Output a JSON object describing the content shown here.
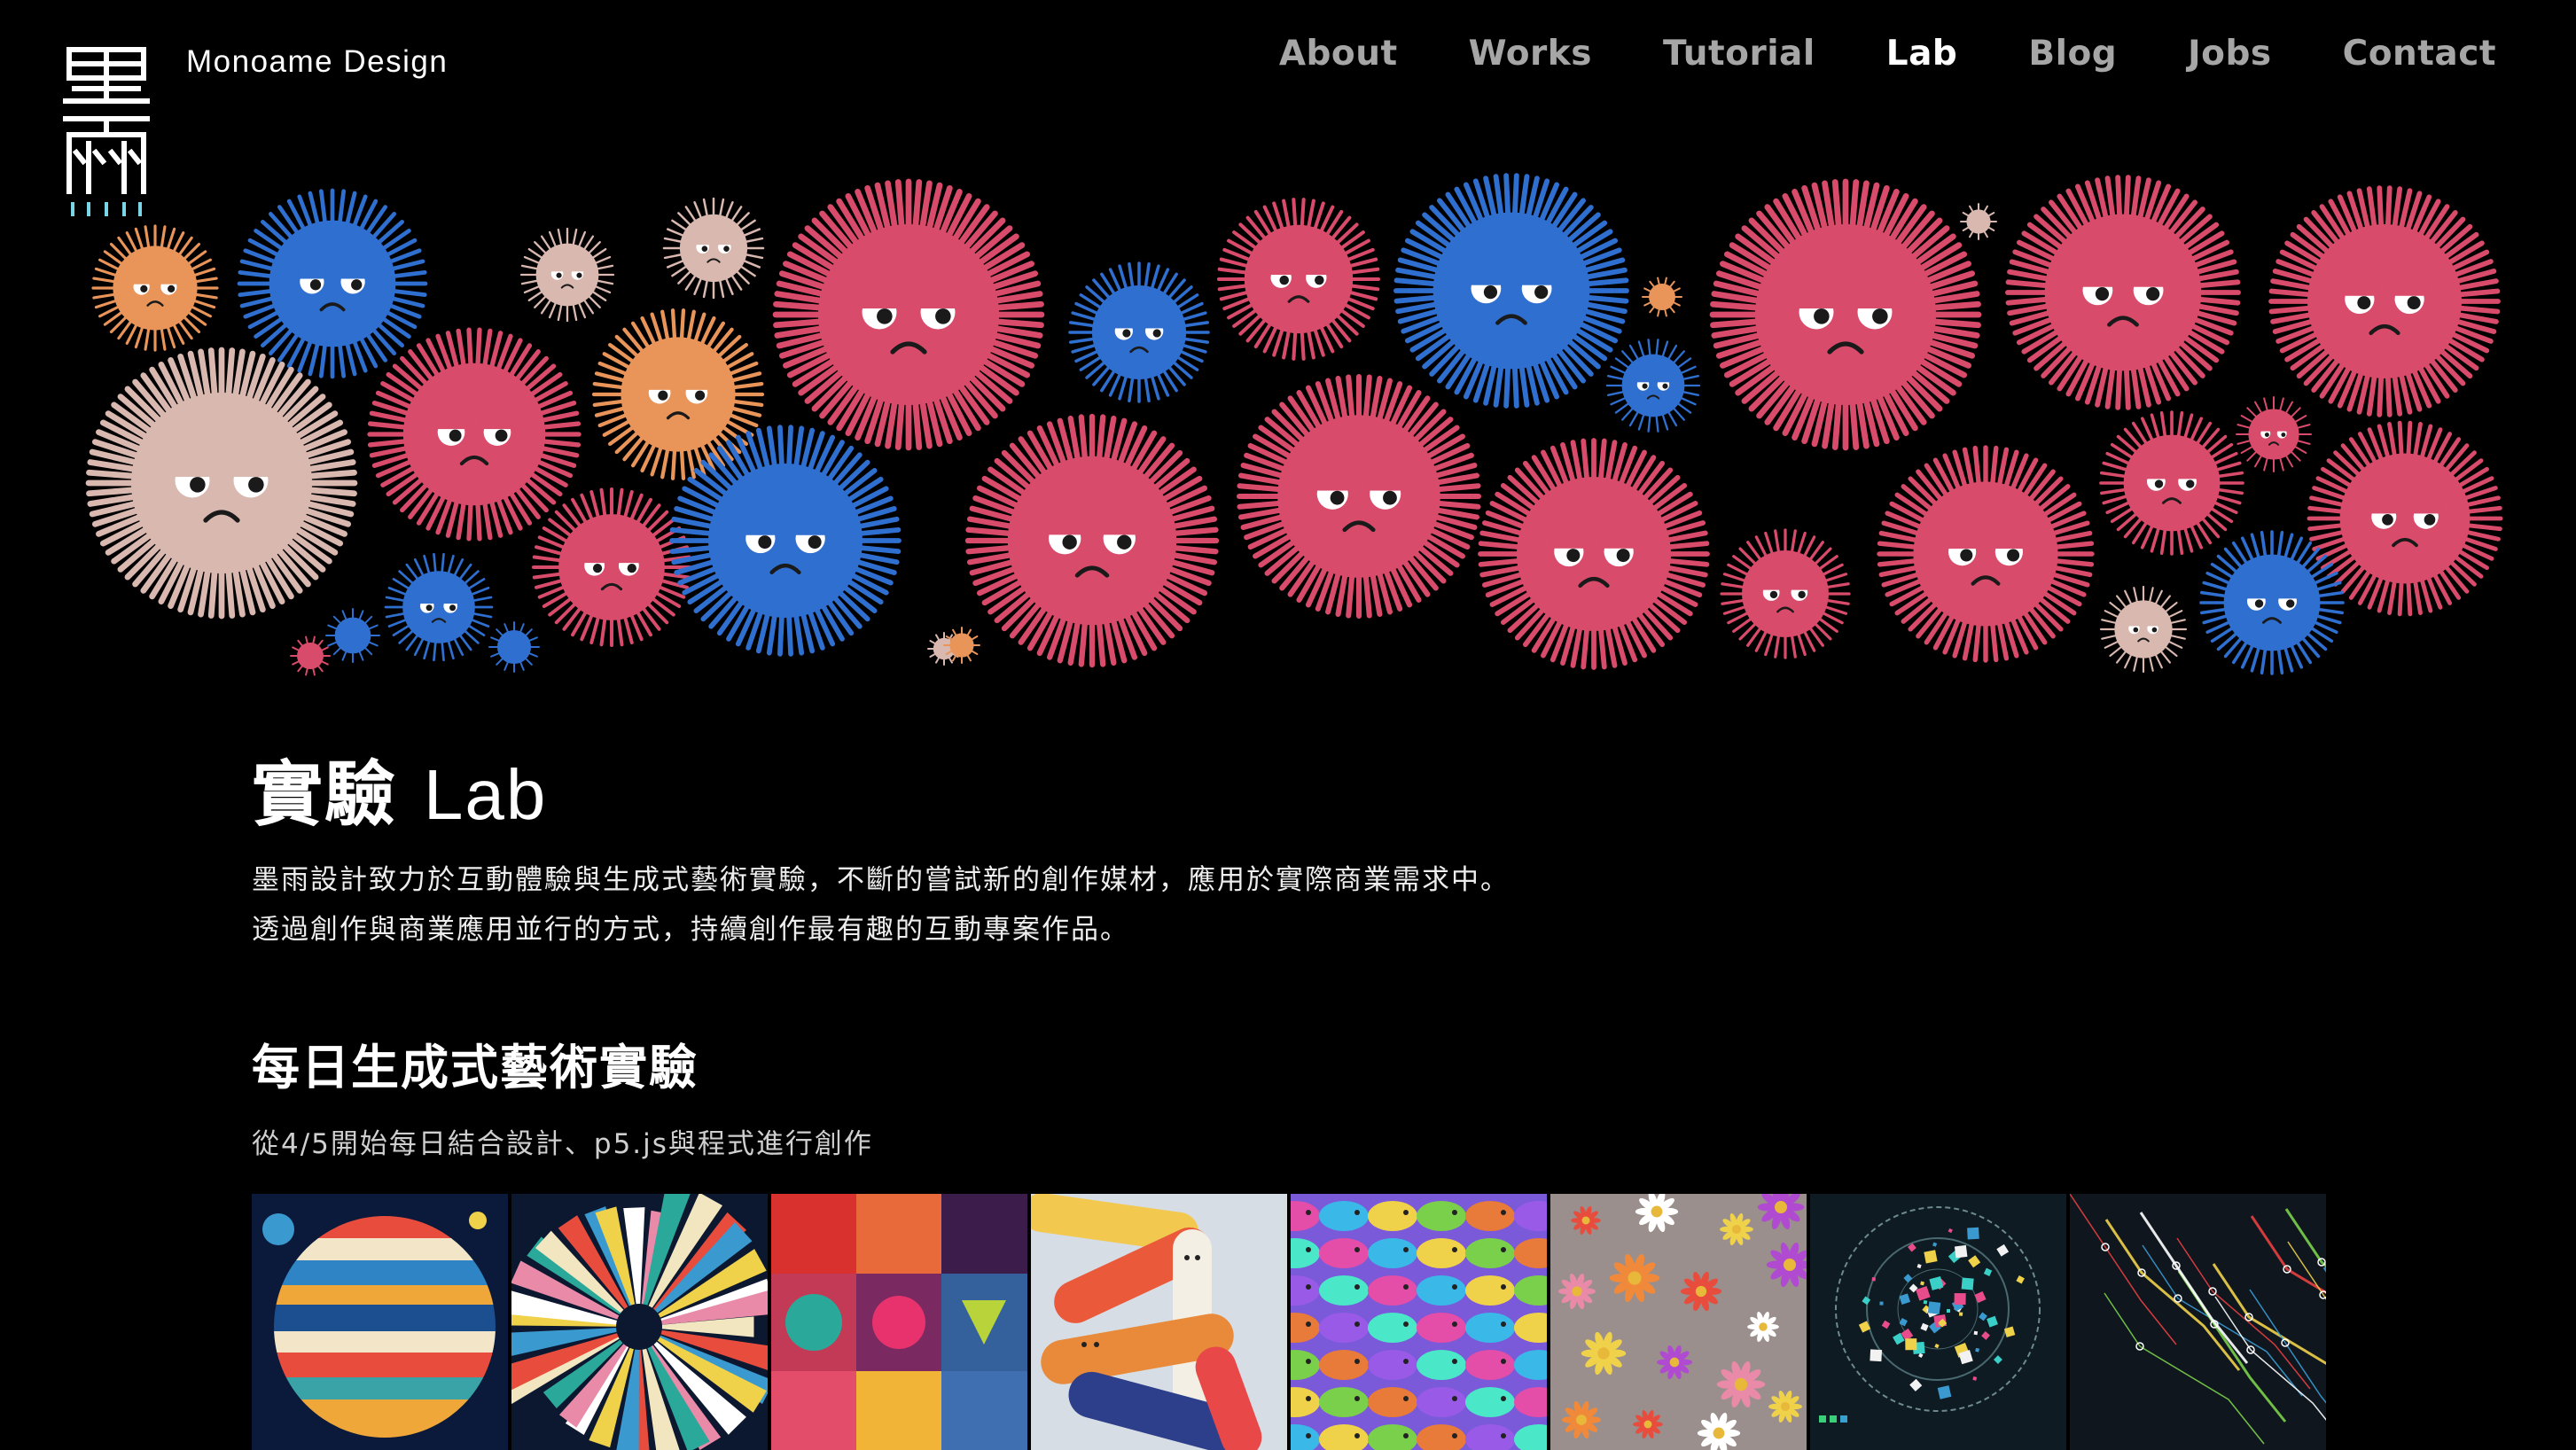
{
  "header": {
    "brand": "Monoame Design",
    "logo_icon": "monoame-logo-icon",
    "nav": [
      {
        "label": "About",
        "active": false
      },
      {
        "label": "Works",
        "active": false
      },
      {
        "label": "Tutorial",
        "active": false
      },
      {
        "label": "Lab",
        "active": true
      },
      {
        "label": "Blog",
        "active": false
      },
      {
        "label": "Jobs",
        "active": false
      },
      {
        "label": "Contact",
        "active": false
      }
    ]
  },
  "hero": {
    "illustration": "germ-creatures-illustration",
    "colors": [
      "#d94b6a",
      "#2f6fd0",
      "#e9955a",
      "#d9b8b0"
    ]
  },
  "lab": {
    "title_cjk": "實驗",
    "title_latin": "Lab",
    "intro_line1": "墨雨設計致力於互動體驗與生成式藝術實驗，不斷的嘗試新的創作媒材，應用於實際商業需求中。",
    "intro_line2": "透過創作與商業應用並行的方式，持續創作最有趣的互動專案作品。"
  },
  "daily": {
    "title": "每日生成式藝術實驗",
    "subtitle": "從4/5開始每日結合設計、p5.js與程式進行創作",
    "thumbnails": [
      "striped-planet-thumbnail",
      "radial-burst-thumbnail",
      "color-blocks-thumbnail",
      "sausage-characters-thumbnail",
      "rainbow-fish-thumbnail",
      "flower-field-thumbnail",
      "particle-radar-thumbnail",
      "network-lines-thumbnail"
    ]
  }
}
